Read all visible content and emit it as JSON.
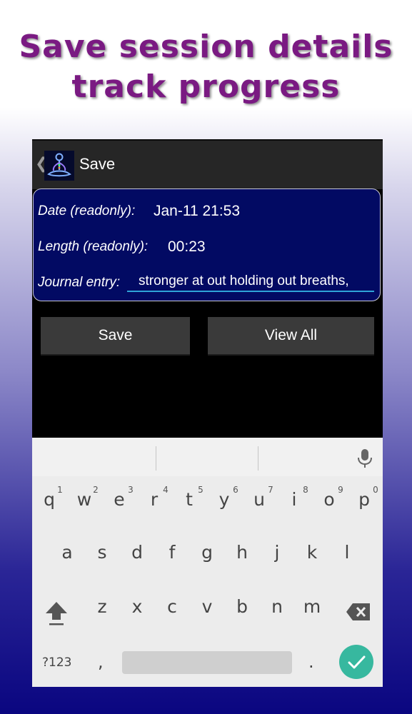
{
  "headline": {
    "line1": "Save session details",
    "line2": "track progress"
  },
  "action_bar": {
    "back_glyph": "❮",
    "title": "Save",
    "logo_icon": "meditation-figure-icon"
  },
  "form": {
    "date_label": "Date (readonly):",
    "date_value": "Jan-11 21:53",
    "length_label": "Length (readonly):",
    "length_value": "00:23",
    "journal_label": "Journal entry:",
    "journal_value": "stronger at out holding out breaths,"
  },
  "buttons": {
    "save": "Save",
    "view_all": "View All"
  },
  "keyboard": {
    "row1": [
      "q",
      "w",
      "e",
      "r",
      "t",
      "y",
      "u",
      "i",
      "o",
      "p"
    ],
    "row1_hints": [
      "1",
      "2",
      "3",
      "4",
      "5",
      "6",
      "7",
      "8",
      "9",
      "0"
    ],
    "row2": [
      "a",
      "s",
      "d",
      "f",
      "g",
      "h",
      "j",
      "k",
      "l"
    ],
    "row3": [
      "z",
      "x",
      "c",
      "v",
      "b",
      "n",
      "m"
    ],
    "symbols_key": "?123",
    "comma": ",",
    "period": "."
  },
  "colors": {
    "headline": "#7a1a82",
    "form_bg": "#020a63",
    "accent": "#2fa4d8",
    "enter_key": "#37b89f"
  }
}
